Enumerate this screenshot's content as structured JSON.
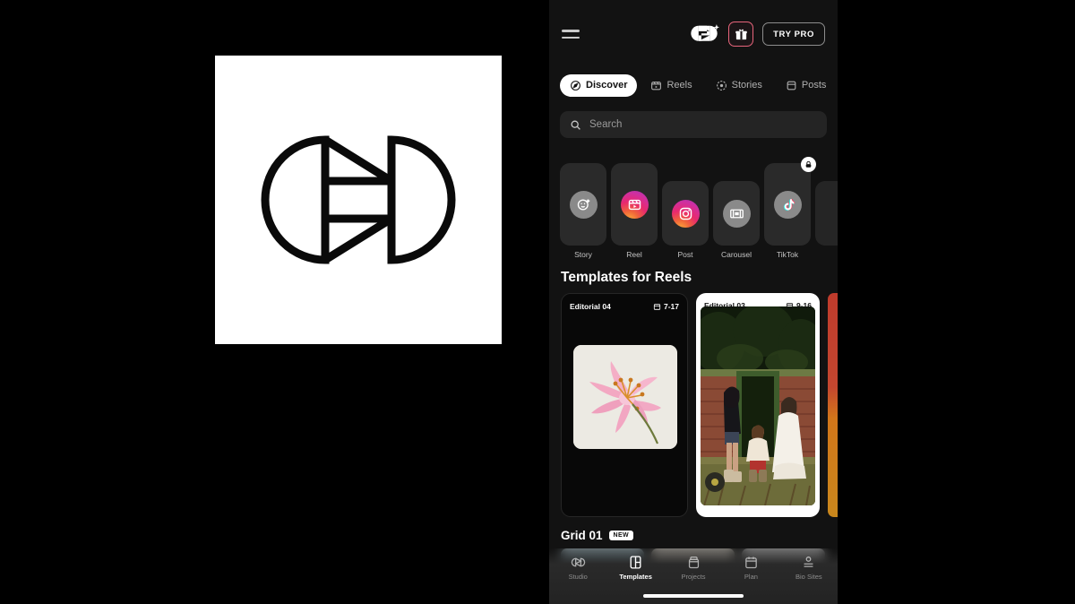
{
  "logo": {
    "name": "interlocking-rings-logo",
    "alt": "Mojo interlocking circles mark"
  },
  "phone": {
    "header": {
      "menu_icon": "hamburger-icon",
      "brand_icon": "brand-sparkle-logo-icon",
      "gift_icon": "gift-icon",
      "try_pro_label": "TRY PRO"
    },
    "tabs": [
      {
        "label": "Discover",
        "icon": "compass-icon",
        "active": true
      },
      {
        "label": "Reels",
        "icon": "reels-icon",
        "active": false
      },
      {
        "label": "Stories",
        "icon": "stories-icon",
        "active": false
      },
      {
        "label": "Posts",
        "icon": "posts-icon",
        "active": false
      }
    ],
    "search": {
      "placeholder": "Search",
      "value": "",
      "icon": "search-icon"
    },
    "categories": [
      {
        "label": "Story",
        "icon": "story-icon",
        "style": "gray",
        "height": "tall",
        "locked": false
      },
      {
        "label": "Reel",
        "icon": "reel-icon",
        "style": "ig",
        "height": "tall",
        "locked": false
      },
      {
        "label": "Post",
        "icon": "post-icon",
        "style": "ig",
        "height": "short",
        "locked": false
      },
      {
        "label": "Carousel",
        "icon": "carousel-icon",
        "style": "gray",
        "height": "short",
        "locked": false
      },
      {
        "label": "TikTok",
        "icon": "tiktok-icon",
        "style": "tt",
        "height": "tall",
        "locked": true
      }
    ],
    "templates_section": {
      "title": "Templates for Reels",
      "cards": [
        {
          "name": "Editorial 04",
          "ratio": "7-17",
          "theme": "dark",
          "media": "pink-lily-flower"
        },
        {
          "name": "Editorial 03",
          "ratio": "9-16",
          "theme": "white",
          "media": "three-people-barn-door"
        }
      ]
    },
    "grid_section": {
      "title": "Grid 01",
      "badge": "NEW"
    },
    "bottom_nav": [
      {
        "label": "Studio",
        "icon": "studio-rings-icon",
        "active": false
      },
      {
        "label": "Templates",
        "icon": "templates-icon",
        "active": true
      },
      {
        "label": "Projects",
        "icon": "projects-icon",
        "active": false
      },
      {
        "label": "Plan",
        "icon": "plan-calendar-icon",
        "active": false
      },
      {
        "label": "Bio Sites",
        "icon": "bio-sites-icon",
        "active": false
      }
    ]
  },
  "colors": {
    "panel_bg": "#121212",
    "accent_pink": "#e8657c",
    "ig_gradient_start": "#fdb33a",
    "ig_gradient_end": "#9b36b7",
    "active_tab_bg": "#ffffff"
  }
}
